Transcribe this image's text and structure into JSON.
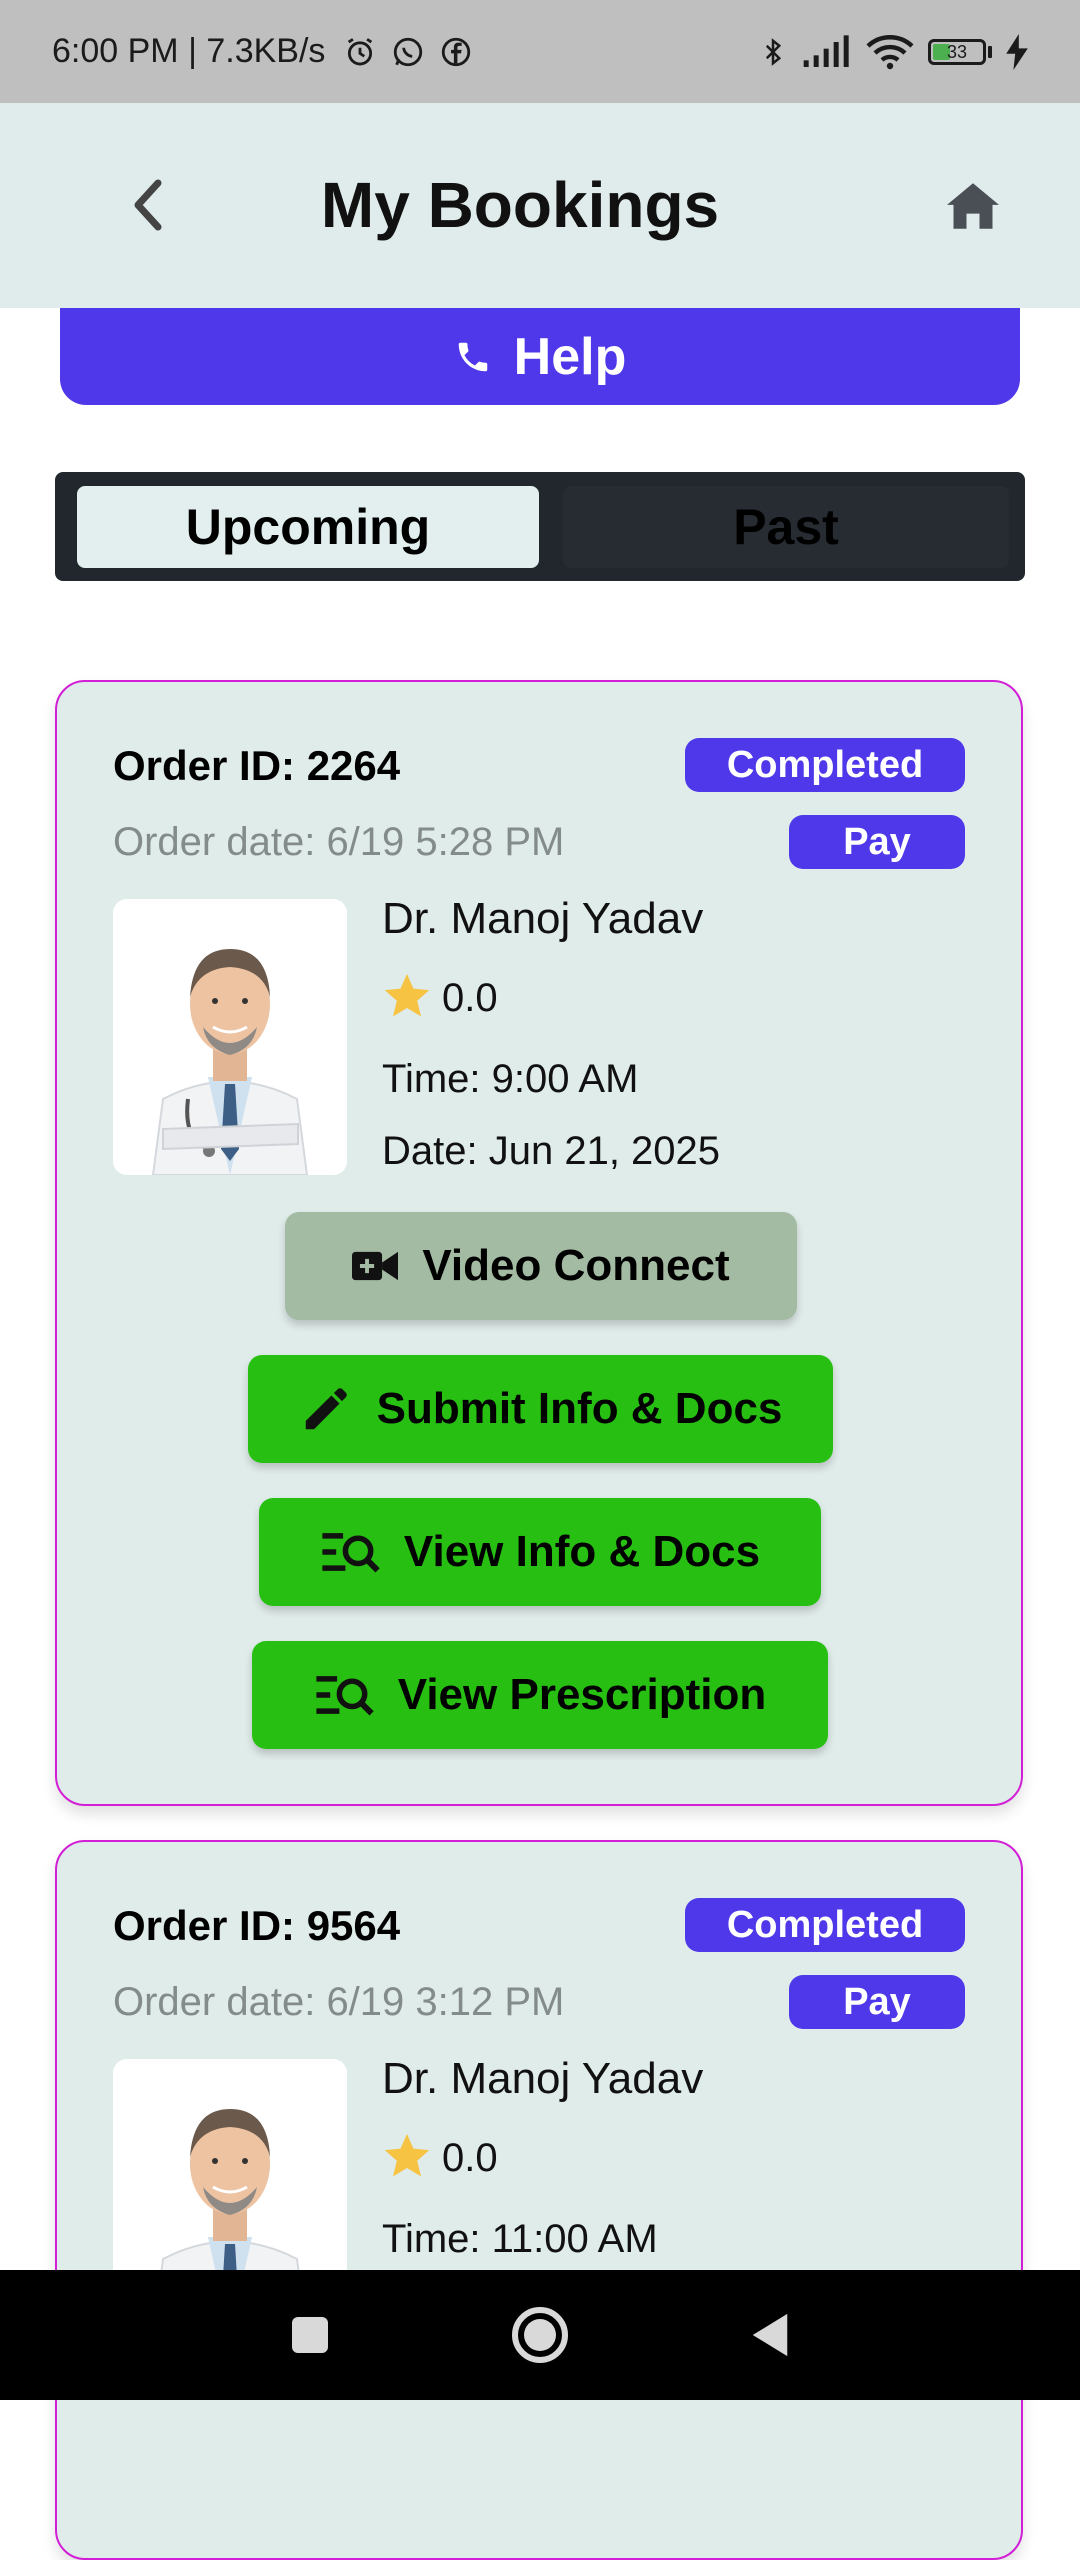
{
  "status_bar": {
    "time_speed": "6:00 PM | 7.3KB/s",
    "battery_level": "33"
  },
  "header": {
    "title": "My Bookings"
  },
  "help_button": {
    "label": "Help"
  },
  "tabs": [
    {
      "label": "Upcoming",
      "active": true
    },
    {
      "label": "Past",
      "active": false
    }
  ],
  "bookings": [
    {
      "order_id": "Order ID: 2264",
      "order_date": "Order date: 6/19 5:28 PM",
      "status": "Completed",
      "pay_label": "Pay",
      "doctor_name": "Dr. Manoj Yadav",
      "rating": "0.0",
      "time": "Time: 9:00 AM",
      "date": "Date: Jun 21, 2025",
      "actions": {
        "video": "Video Connect",
        "submit": "Submit Info & Docs",
        "view_info": "View Info & Docs",
        "prescription": "View Prescription"
      }
    },
    {
      "order_id": "Order ID: 9564",
      "order_date": "Order date: 6/19 3:12 PM",
      "status": "Completed",
      "pay_label": "Pay",
      "doctor_name": "Dr. Manoj Yadav",
      "rating": "0.0",
      "time": "Time: 11:00 AM"
    }
  ],
  "colors": {
    "accent": "#4e38ea",
    "action_green": "#27c012",
    "video_button": "#a4bba3",
    "card_border": "#d21ed6",
    "card_bg": "#e0ecea",
    "header_bg": "#dfeceb"
  }
}
